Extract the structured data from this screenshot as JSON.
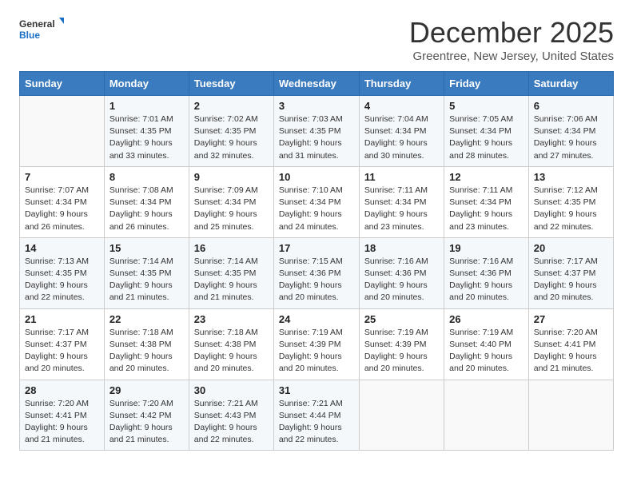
{
  "header": {
    "logo_line1": "General",
    "logo_line2": "Blue",
    "month": "December 2025",
    "location": "Greentree, New Jersey, United States"
  },
  "weekdays": [
    "Sunday",
    "Monday",
    "Tuesday",
    "Wednesday",
    "Thursday",
    "Friday",
    "Saturday"
  ],
  "weeks": [
    [
      {
        "day": "",
        "text": ""
      },
      {
        "day": "1",
        "text": "Sunrise: 7:01 AM\nSunset: 4:35 PM\nDaylight: 9 hours\nand 33 minutes."
      },
      {
        "day": "2",
        "text": "Sunrise: 7:02 AM\nSunset: 4:35 PM\nDaylight: 9 hours\nand 32 minutes."
      },
      {
        "day": "3",
        "text": "Sunrise: 7:03 AM\nSunset: 4:35 PM\nDaylight: 9 hours\nand 31 minutes."
      },
      {
        "day": "4",
        "text": "Sunrise: 7:04 AM\nSunset: 4:34 PM\nDaylight: 9 hours\nand 30 minutes."
      },
      {
        "day": "5",
        "text": "Sunrise: 7:05 AM\nSunset: 4:34 PM\nDaylight: 9 hours\nand 28 minutes."
      },
      {
        "day": "6",
        "text": "Sunrise: 7:06 AM\nSunset: 4:34 PM\nDaylight: 9 hours\nand 27 minutes."
      }
    ],
    [
      {
        "day": "7",
        "text": "Sunrise: 7:07 AM\nSunset: 4:34 PM\nDaylight: 9 hours\nand 26 minutes."
      },
      {
        "day": "8",
        "text": "Sunrise: 7:08 AM\nSunset: 4:34 PM\nDaylight: 9 hours\nand 26 minutes."
      },
      {
        "day": "9",
        "text": "Sunrise: 7:09 AM\nSunset: 4:34 PM\nDaylight: 9 hours\nand 25 minutes."
      },
      {
        "day": "10",
        "text": "Sunrise: 7:10 AM\nSunset: 4:34 PM\nDaylight: 9 hours\nand 24 minutes."
      },
      {
        "day": "11",
        "text": "Sunrise: 7:11 AM\nSunset: 4:34 PM\nDaylight: 9 hours\nand 23 minutes."
      },
      {
        "day": "12",
        "text": "Sunrise: 7:11 AM\nSunset: 4:34 PM\nDaylight: 9 hours\nand 23 minutes."
      },
      {
        "day": "13",
        "text": "Sunrise: 7:12 AM\nSunset: 4:35 PM\nDaylight: 9 hours\nand 22 minutes."
      }
    ],
    [
      {
        "day": "14",
        "text": "Sunrise: 7:13 AM\nSunset: 4:35 PM\nDaylight: 9 hours\nand 22 minutes."
      },
      {
        "day": "15",
        "text": "Sunrise: 7:14 AM\nSunset: 4:35 PM\nDaylight: 9 hours\nand 21 minutes."
      },
      {
        "day": "16",
        "text": "Sunrise: 7:14 AM\nSunset: 4:35 PM\nDaylight: 9 hours\nand 21 minutes."
      },
      {
        "day": "17",
        "text": "Sunrise: 7:15 AM\nSunset: 4:36 PM\nDaylight: 9 hours\nand 20 minutes."
      },
      {
        "day": "18",
        "text": "Sunrise: 7:16 AM\nSunset: 4:36 PM\nDaylight: 9 hours\nand 20 minutes."
      },
      {
        "day": "19",
        "text": "Sunrise: 7:16 AM\nSunset: 4:36 PM\nDaylight: 9 hours\nand 20 minutes."
      },
      {
        "day": "20",
        "text": "Sunrise: 7:17 AM\nSunset: 4:37 PM\nDaylight: 9 hours\nand 20 minutes."
      }
    ],
    [
      {
        "day": "21",
        "text": "Sunrise: 7:17 AM\nSunset: 4:37 PM\nDaylight: 9 hours\nand 20 minutes."
      },
      {
        "day": "22",
        "text": "Sunrise: 7:18 AM\nSunset: 4:38 PM\nDaylight: 9 hours\nand 20 minutes."
      },
      {
        "day": "23",
        "text": "Sunrise: 7:18 AM\nSunset: 4:38 PM\nDaylight: 9 hours\nand 20 minutes."
      },
      {
        "day": "24",
        "text": "Sunrise: 7:19 AM\nSunset: 4:39 PM\nDaylight: 9 hours\nand 20 minutes."
      },
      {
        "day": "25",
        "text": "Sunrise: 7:19 AM\nSunset: 4:39 PM\nDaylight: 9 hours\nand 20 minutes."
      },
      {
        "day": "26",
        "text": "Sunrise: 7:19 AM\nSunset: 4:40 PM\nDaylight: 9 hours\nand 20 minutes."
      },
      {
        "day": "27",
        "text": "Sunrise: 7:20 AM\nSunset: 4:41 PM\nDaylight: 9 hours\nand 21 minutes."
      }
    ],
    [
      {
        "day": "28",
        "text": "Sunrise: 7:20 AM\nSunset: 4:41 PM\nDaylight: 9 hours\nand 21 minutes."
      },
      {
        "day": "29",
        "text": "Sunrise: 7:20 AM\nSunset: 4:42 PM\nDaylight: 9 hours\nand 21 minutes."
      },
      {
        "day": "30",
        "text": "Sunrise: 7:21 AM\nSunset: 4:43 PM\nDaylight: 9 hours\nand 22 minutes."
      },
      {
        "day": "31",
        "text": "Sunrise: 7:21 AM\nSunset: 4:44 PM\nDaylight: 9 hours\nand 22 minutes."
      },
      {
        "day": "",
        "text": ""
      },
      {
        "day": "",
        "text": ""
      },
      {
        "day": "",
        "text": ""
      }
    ]
  ]
}
